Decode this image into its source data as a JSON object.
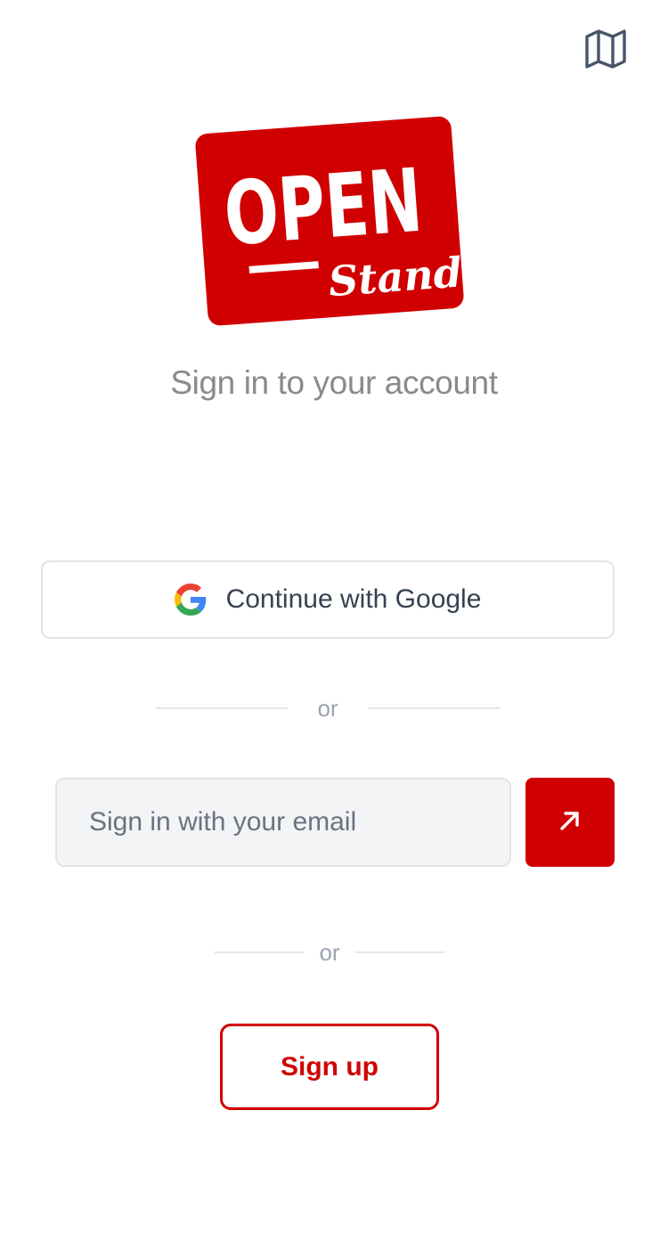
{
  "header": {
    "map_icon": "map-icon"
  },
  "logo": {
    "main_text": "OPEN",
    "script_text": "Stand",
    "background_color": "#d10000",
    "text_color": "#ffffff"
  },
  "title": "Sign in to your account",
  "google": {
    "label": "Continue with Google",
    "icon": "google-icon"
  },
  "divider_1": {
    "text": "or"
  },
  "email": {
    "placeholder": "Sign in with your email",
    "value": "",
    "submit_icon": "arrow-up-right-icon"
  },
  "divider_2": {
    "text": "or"
  },
  "signup": {
    "label": "Sign up"
  },
  "colors": {
    "accent": "#d10000",
    "title_text": "#8a8a8a",
    "input_background": "#f3f4f6",
    "border": "#e2e4e8"
  }
}
